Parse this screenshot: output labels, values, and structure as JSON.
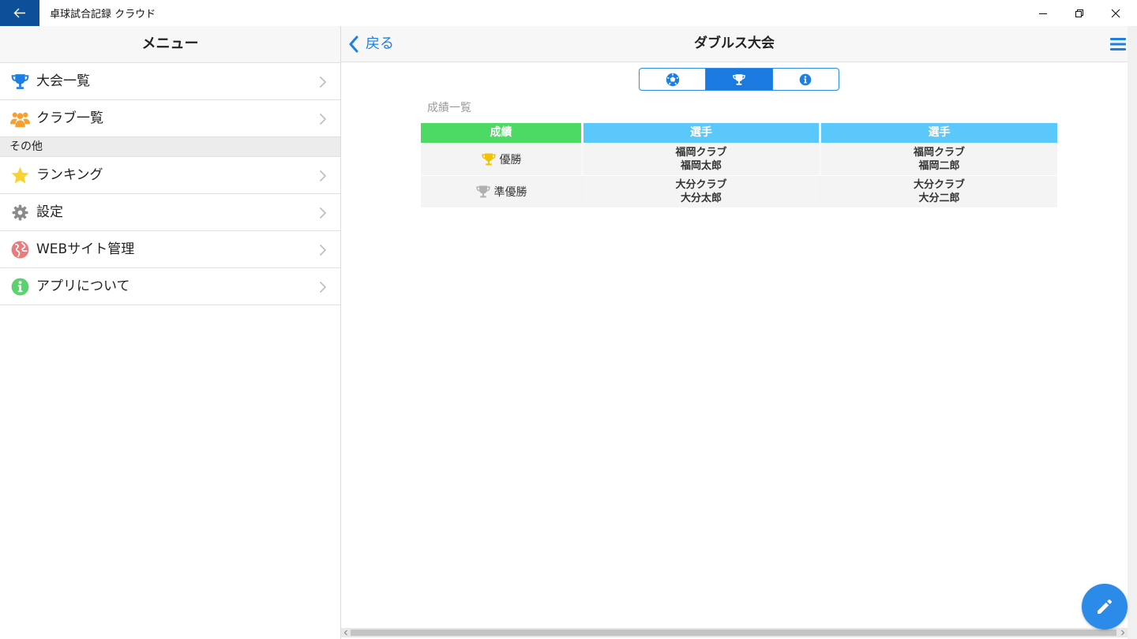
{
  "window": {
    "title": "卓球試合記録 クラウド"
  },
  "menu": {
    "title": "メニュー",
    "items": [
      {
        "label": "大会一覧",
        "icon": "trophy-icon",
        "color": "#1c7fe4"
      },
      {
        "label": "クラブ一覧",
        "icon": "group-icon",
        "color": "#f7a030"
      }
    ],
    "section_other": "その他",
    "other_items": [
      {
        "label": "ランキング",
        "icon": "star-icon",
        "color": "#f8d330"
      },
      {
        "label": "設定",
        "icon": "gear-icon",
        "color": "#8a8a8a"
      },
      {
        "label": "WEBサイト管理",
        "icon": "globe-icon",
        "color": "#e87c7c"
      },
      {
        "label": "アプリについて",
        "icon": "info-icon",
        "color": "#5bd16f"
      }
    ]
  },
  "detail": {
    "back_label": "戻る",
    "title": "ダブルス大会",
    "tabs": [
      {
        "icon": "ball-icon",
        "active": false
      },
      {
        "icon": "trophy-icon",
        "active": true
      },
      {
        "icon": "info-icon",
        "active": false
      }
    ],
    "results_label": "成績一覧",
    "columns": [
      "成績",
      "選手",
      "選手"
    ],
    "rows": [
      {
        "rank": "優勝",
        "trophy_color": "#f2c200",
        "player1": {
          "club": "福岡クラブ",
          "name": "福岡太郎"
        },
        "player2": {
          "club": "福岡クラブ",
          "name": "福岡二郎"
        }
      },
      {
        "rank": "準優勝",
        "trophy_color": "#b0b0b0",
        "player1": {
          "club": "大分クラブ",
          "name": "大分太郎"
        },
        "player2": {
          "club": "大分クラブ",
          "name": "大分二郎"
        }
      }
    ]
  },
  "colors": {
    "accent": "#1c7fe4",
    "rank_header": "#4cd964",
    "player_header": "#5ac8fa",
    "titlebar_back": "#0e4f99"
  }
}
